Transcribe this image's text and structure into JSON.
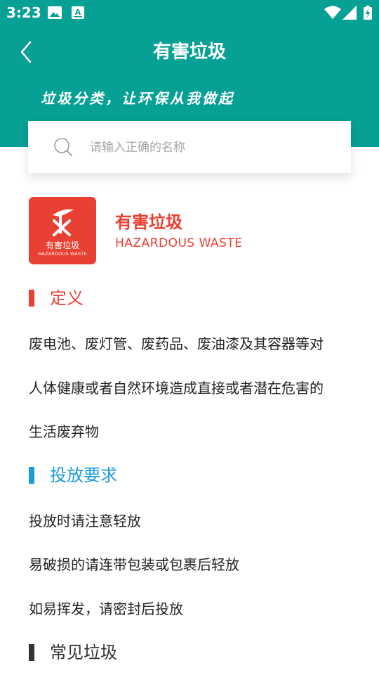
{
  "status_bar": {
    "time": "3:23",
    "icons": [
      "image-icon",
      "font-icon",
      "wifi-icon",
      "signal-icon",
      "battery-icon"
    ]
  },
  "header": {
    "title": "有害垃圾",
    "slogan": "垃圾分类，让环保从我做起",
    "background_color": "#07a095"
  },
  "search": {
    "placeholder": "请输入正确的名称",
    "value": ""
  },
  "category": {
    "logo_cn": "有害垃圾",
    "logo_en": "HAZARDOUS WASTE",
    "title": "有害垃圾",
    "subtitle": "HAZARDOUS WASTE",
    "color": "#e84033"
  },
  "sections": {
    "definition": {
      "title": "定义",
      "color": "#e84033",
      "lines": [
        "废电池、废灯管、废药品、废油漆及其容器等对",
        "人体健康或者自然环境造成直接或者潜在危害的",
        "生活废弃物"
      ]
    },
    "requirements": {
      "title": "投放要求",
      "color": "#1a9be0",
      "lines": [
        "投放时请注意轻放",
        "易破损的请连带包装或包裹后轻放",
        "如易挥发，请密封后投放"
      ]
    },
    "common": {
      "title": "常见垃圾",
      "color": "#333333"
    }
  }
}
